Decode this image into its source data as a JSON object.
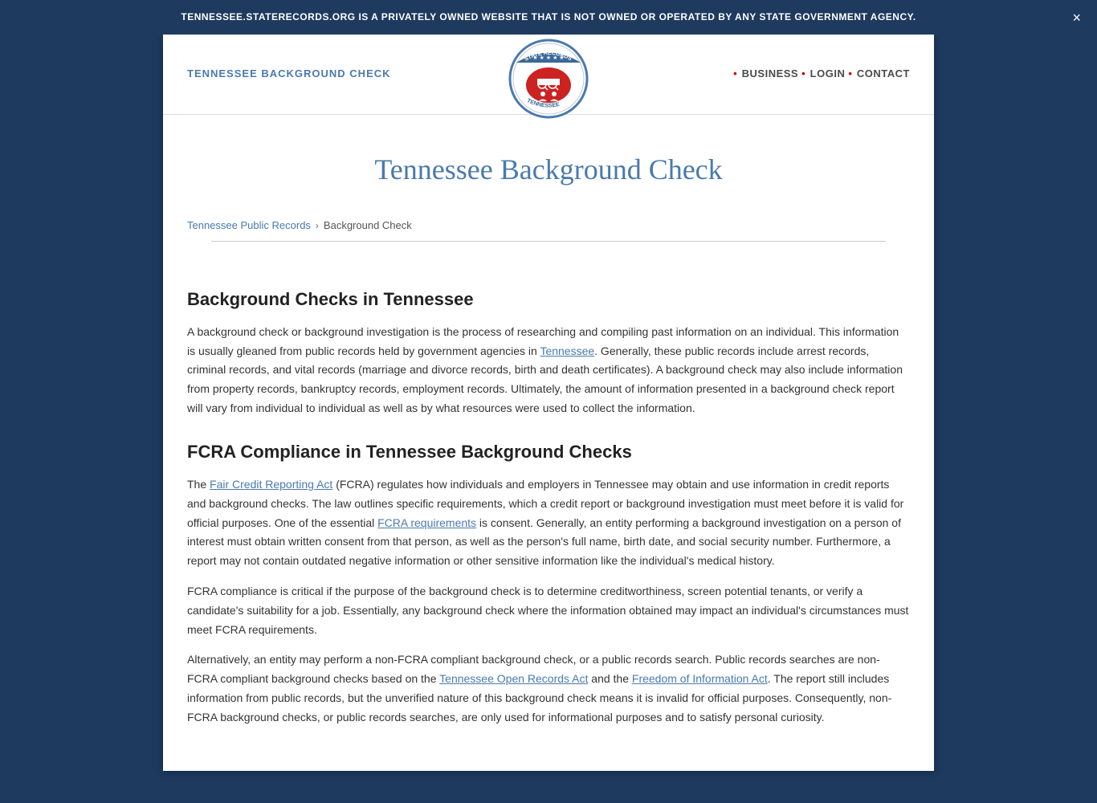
{
  "banner": {
    "text": "TENNESSEE.STATERECORDS.ORG IS A PRIVATELY OWNED WEBSITE THAT IS NOT OWNED OR OPERATED BY ANY STATE GOVERNMENT AGENCY.",
    "close_label": "×"
  },
  "header": {
    "site_title": "TENNESSEE BACKGROUND CHECK",
    "nav": {
      "business_label": "BUSINESS",
      "login_label": "LOGIN",
      "contact_label": "CONTACT"
    }
  },
  "page": {
    "title": "Tennessee Background Check",
    "breadcrumb": {
      "parent": "Tennessee Public Records",
      "current": "Background Check"
    }
  },
  "sections": [
    {
      "id": "section-background-checks",
      "heading": "Background Checks in Tennessee",
      "paragraphs": [
        "A background check or background investigation is the process of researching and compiling past information on an individual. This information is usually gleaned from public records held by government agencies in Tennessee. Generally, these public records include arrest records, criminal records, and vital records (marriage and divorce records, birth and death certificates). A background check may also include information from property records, bankruptcy records, employment records. Ultimately, the amount of information presented in a background check report will vary from individual to individual as well as by what resources were used to collect the information."
      ]
    },
    {
      "id": "section-fcra",
      "heading": "FCRA Compliance in Tennessee Background Checks",
      "paragraphs": [
        "The Fair Credit Reporting Act (FCRA) regulates how individuals and employers in Tennessee may obtain and use information in credit reports and background checks. The law outlines specific requirements, which a credit report or background investigation must meet before it is valid for official purposes. One of the essential FCRA requirements is consent. Generally, an entity performing a background investigation on a person of interest must obtain written consent from that person, as well as the person's full name, birth date, and social security number. Furthermore, a report may not contain outdated negative information or other sensitive information like the individual's medical history.",
        "FCRA compliance is critical if the purpose of the background check is to determine creditworthiness, screen potential tenants, or verify a candidate's suitability for a job. Essentially, any background check where the information obtained may impact an individual's circumstances must meet FCRA requirements.",
        "Alternatively, an entity may perform a non-FCRA compliant background check, or a public records search. Public records searches are non-FCRA compliant background checks based on the Tennessee Open Records Act and the Freedom of Information Act. The report still includes information from public records, but the unverified nature of this background check means it is invalid for official purposes. Consequently, non-FCRA background checks, or public records searches, are only used for informational purposes and to satisfy personal curiosity."
      ]
    }
  ]
}
